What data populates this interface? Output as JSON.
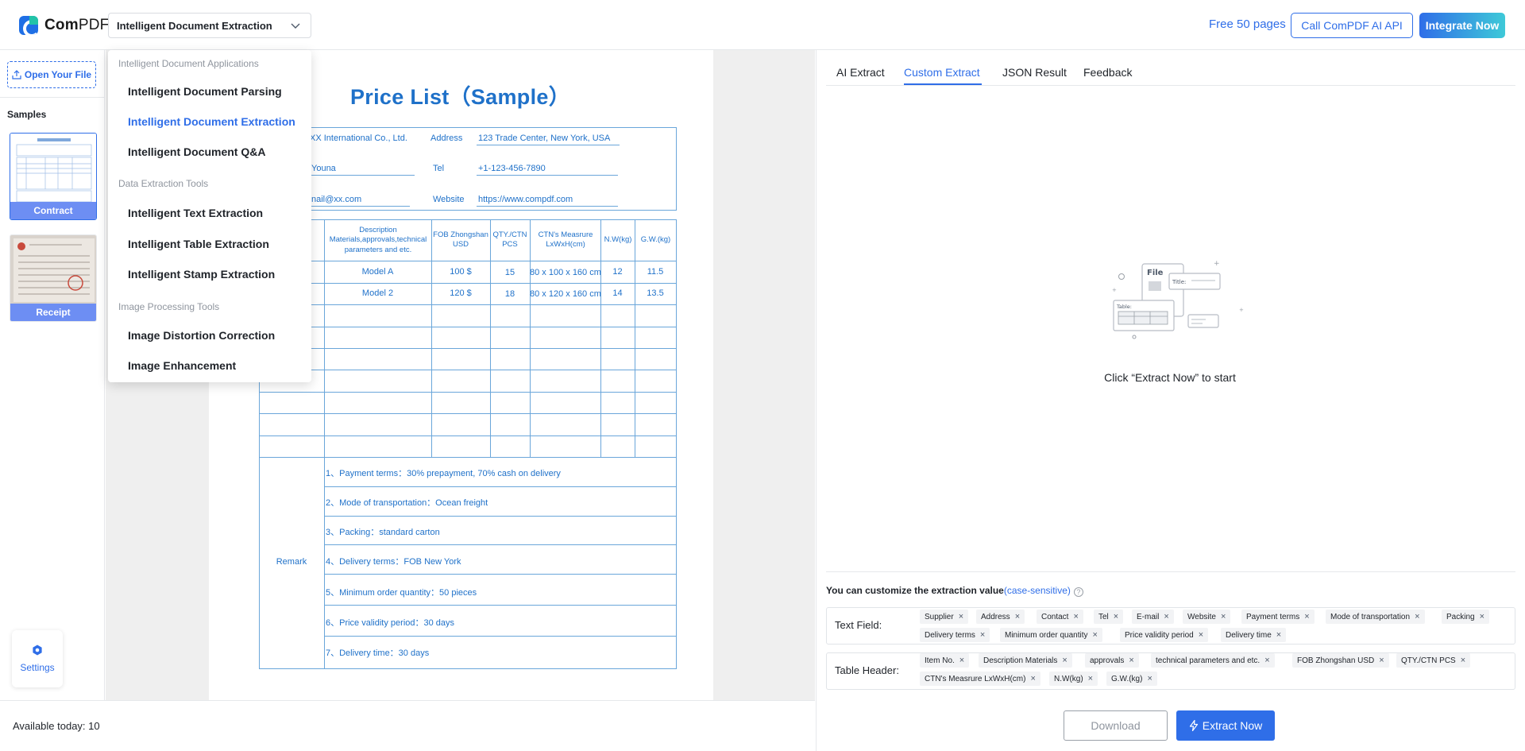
{
  "header": {
    "logo_prefix": "Com",
    "logo_suffix": "PDF",
    "app_select_value": "Intelligent Document Extraction",
    "free_pages": "Free 50 pages",
    "call_api": "Call ComPDF AI API",
    "integrate": "Integrate Now"
  },
  "sidebar": {
    "open_file": "Open Your File",
    "samples_title": "Samples",
    "samples": [
      {
        "label": "Contract"
      },
      {
        "label": "Receipt"
      }
    ],
    "settings": "Settings"
  },
  "dropdown": {
    "groups": [
      {
        "title": "Intelligent Document Applications",
        "items": [
          "Intelligent Document Parsing",
          "Intelligent Document Extraction",
          "Intelligent Document Q&A"
        ]
      },
      {
        "title": "Data Extraction Tools",
        "items": [
          "Intelligent Text Extraction",
          "Intelligent Table Extraction",
          "Intelligent Stamp Extraction"
        ]
      },
      {
        "title": "Image Processing Tools",
        "items": [
          "Image Distortion Correction",
          "Image Enhancement"
        ]
      }
    ],
    "active_item": "Intelligent Document Extraction"
  },
  "document": {
    "title": "Price List（Sample）",
    "company": "XX International Co., Ltd.",
    "address_label": "Address",
    "address": "123 Trade Center, New York, USA",
    "contact": "Youna",
    "tel_label": "Tel",
    "tel": "+1-123-456-7890",
    "email": "nail@xx.com",
    "website_label": "Website",
    "website": "https://www.compdf.com",
    "table_headers": [
      "Description Materials,approvals,technical parameters and etc.",
      "FOB Zhongshan USD",
      "QTY./CTN PCS",
      "CTN's Measrure LxWxH(cm)",
      "N.W(kg)",
      "G.W.(kg)"
    ],
    "rows": [
      [
        "Model A",
        "100 $",
        "15",
        "80 x 100 x 160 cm",
        "12",
        "11.5"
      ],
      [
        "Model 2",
        "120 $",
        "18",
        "80 x 120 x 160 cm",
        "14",
        "13.5"
      ]
    ],
    "remark_label": "Remark",
    "remarks": [
      "1、Payment terms：30% prepayment, 70% cash on delivery",
      "2、Mode of transportation：Ocean freight",
      "3、Packing：standard carton",
      "4、Delivery terms：FOB New York",
      "5、Minimum order quantity：50 pieces",
      "6、Price validity period：30 days",
      "7、Delivery time：30 days"
    ]
  },
  "viewer_footer": {
    "available": "Available today: 10"
  },
  "right": {
    "tabs": [
      "AI Extract",
      "Custom Extract",
      "JSON Result",
      "Feedback"
    ],
    "active_tab": "Custom Extract",
    "illus_file": "File",
    "illus_title": "Title:",
    "illus_table": "Table:",
    "empty_text": "Click “Extract Now” to start",
    "custom_label": "You can customize the extraction value",
    "case_sensitive": "(case-sensitive)",
    "help": "?",
    "text_field_label": "Text Field:",
    "text_fields": [
      "Supplier",
      "Address",
      "Contact",
      "Tel",
      "E-mail",
      "Website",
      "Payment terms",
      "Mode of transportation",
      "Packing",
      "Delivery terms",
      "Minimum order quantity",
      "Price validity period",
      "Delivery time"
    ],
    "table_header_label": "Table Header:",
    "table_headers": [
      "Item No.",
      "Description Materials",
      "approvals",
      "technical parameters and etc.",
      "FOB Zhongshan USD",
      "QTY./CTN PCS",
      "CTN's Measrure LxWxH(cm)",
      "N.W(kg)",
      "G.W.(kg)"
    ],
    "download": "Download",
    "extract": "Extract Now",
    "chip_remove": "×"
  },
  "colors": {
    "accent": "#2f6ee8",
    "doc_blue": "#1f71c9",
    "sample_caption": "#6d8ef3"
  }
}
